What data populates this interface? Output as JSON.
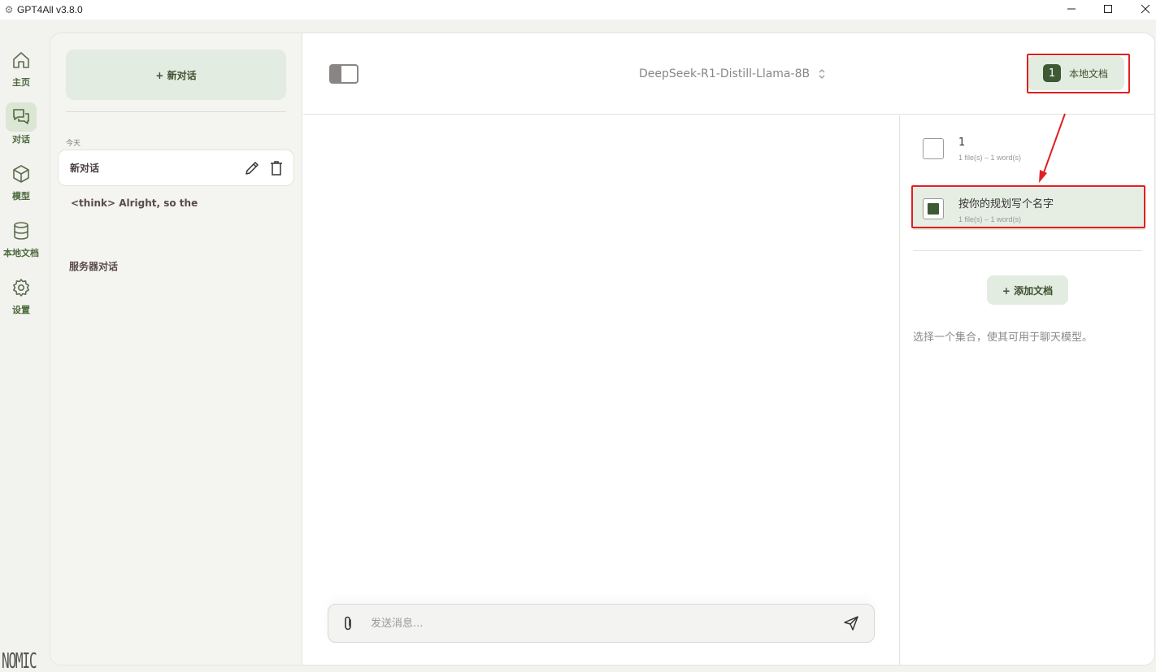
{
  "window": {
    "title": "GPT4All v3.8.0",
    "controls": [
      "minimize",
      "maximize",
      "close"
    ]
  },
  "rail": {
    "items": [
      {
        "label": "主页",
        "icon": "home-icon"
      },
      {
        "label": "对话",
        "icon": "chat-icon",
        "active": true
      },
      {
        "label": "模型",
        "icon": "cube-icon"
      },
      {
        "label": "本地文档",
        "icon": "database-icon"
      },
      {
        "label": "设置",
        "icon": "gear-icon"
      }
    ],
    "brand": "NOMIC"
  },
  "chat_list": {
    "new_chat_label": "+ 新对话",
    "section_today": "今天",
    "items": [
      {
        "name": "新对话",
        "active": true
      },
      {
        "name": "<think> Alright, so the",
        "active": false
      }
    ],
    "section_server": "服务器对话"
  },
  "header": {
    "model_name": "DeepSeek-R1-Distill-Llama-8B",
    "localdocs_count": "1",
    "localdocs_label": "本地文档"
  },
  "input": {
    "placeholder": "发送消息..."
  },
  "docs_panel": {
    "collections": [
      {
        "title": "1",
        "meta": "1 file(s) – 1 word(s)",
        "checked": false
      },
      {
        "title": "按你的规划写个名字",
        "meta": "1 file(s) – 1 word(s)",
        "checked": true
      }
    ],
    "add_label": "+ 添加文档",
    "hint": "选择一个集合，使其可用于聊天模型。"
  },
  "colors": {
    "accent": "#3d5a34",
    "accent_light": "#e3ece0",
    "annotation": "#e02020"
  }
}
